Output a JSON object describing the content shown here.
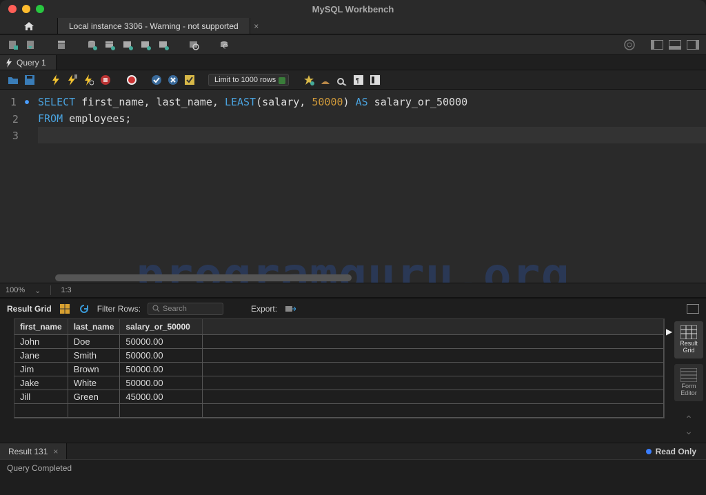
{
  "window": {
    "title": "MySQL Workbench"
  },
  "connection_tab": "Local instance 3306 - Warning - not supported",
  "query_tab": "Query 1",
  "editor": {
    "limit": "Limit to 1000 rows",
    "lines": {
      "1": {
        "raw": "SELECT first_name, last_name, LEAST(salary, 50000) AS salary_or_50000"
      },
      "2": {
        "raw": "FROM employees;"
      },
      "3": {
        "raw": ""
      }
    }
  },
  "zoom": {
    "percent": "100%",
    "pos": "1:3"
  },
  "result": {
    "label": "Result Grid",
    "filter_label": "Filter Rows:",
    "search_placeholder": "Search",
    "export_label": "Export:",
    "columns": [
      "first_name",
      "last_name",
      "salary_or_50000"
    ],
    "rows": [
      [
        "John",
        "Doe",
        "50000.00"
      ],
      [
        "Jane",
        "Smith",
        "50000.00"
      ],
      [
        "Jim",
        "Brown",
        "50000.00"
      ],
      [
        "Jake",
        "White",
        "50000.00"
      ],
      [
        "Jill",
        "Green",
        "45000.00"
      ]
    ],
    "tab": "Result 131",
    "readonly": "Read Only",
    "side": {
      "result_grid": "Result Grid",
      "form_editor": "Form Editor"
    }
  },
  "status": "Query Completed",
  "watermark": "programguru.org"
}
